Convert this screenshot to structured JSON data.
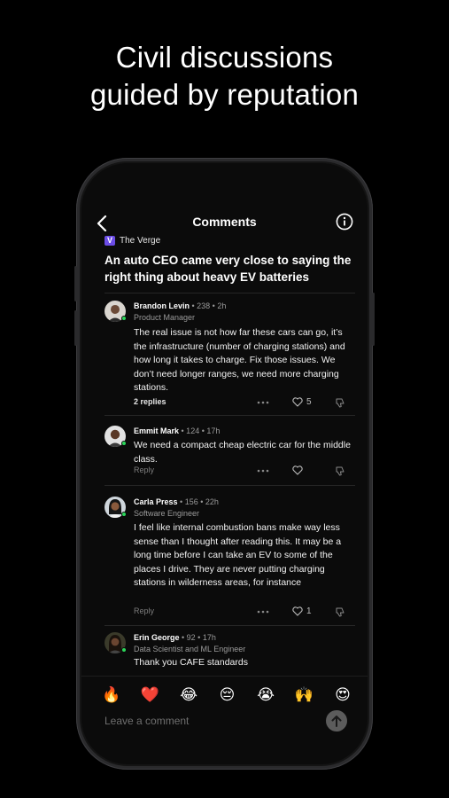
{
  "headline": {
    "line1": "Civil discussions",
    "line2": "guided by reputation"
  },
  "nav": {
    "title": "Comments"
  },
  "article": {
    "source": "The Verge",
    "source_logo": "V",
    "title": "An auto CEO came very close to saying the right thing about heavy EV batteries"
  },
  "comments": [
    {
      "name": "Brandon Levin",
      "meta": " • 238 • 2h",
      "role": "Product Manager",
      "text": "The real issue is not how far these cars can go, it’s the infrastructure (number of charging stations) and how long it takes to charge. Fix those issues. We don’t need longer ranges, we need more charging stations.",
      "reply_label": "2 replies",
      "likes": "5"
    },
    {
      "name": "Emmit Mark",
      "meta": " • 124 • 17h",
      "role": "",
      "text": "We need a compact cheap electric car for the middle class.",
      "reply_label": "Reply",
      "likes": ""
    },
    {
      "name": "Carla Press",
      "meta": " • 156 • 22h",
      "role": "Software Engineer",
      "text": "I feel like internal combustion bans make way less sense than I thought after reading this.  It may be a long time before I can take an EV to some of the places I drive.  They are never putting charging stations in wilderness areas, for instance",
      "reply_label": "Reply",
      "likes": "1"
    },
    {
      "name": "Erin George",
      "meta": " • 92 • 17h",
      "role": "Data Scientist and ML Engineer",
      "text": "Thank you CAFE standards",
      "reply_label": "",
      "likes": ""
    }
  ],
  "reactions": [
    "🔥",
    "❤️",
    "😂",
    "😔",
    "😭",
    "🙌",
    "😍"
  ],
  "composer": {
    "placeholder": "Leave a comment"
  },
  "colors": {
    "background": "#000000",
    "accent_source": "#6b4ce6",
    "presence": "#2bd65a"
  }
}
